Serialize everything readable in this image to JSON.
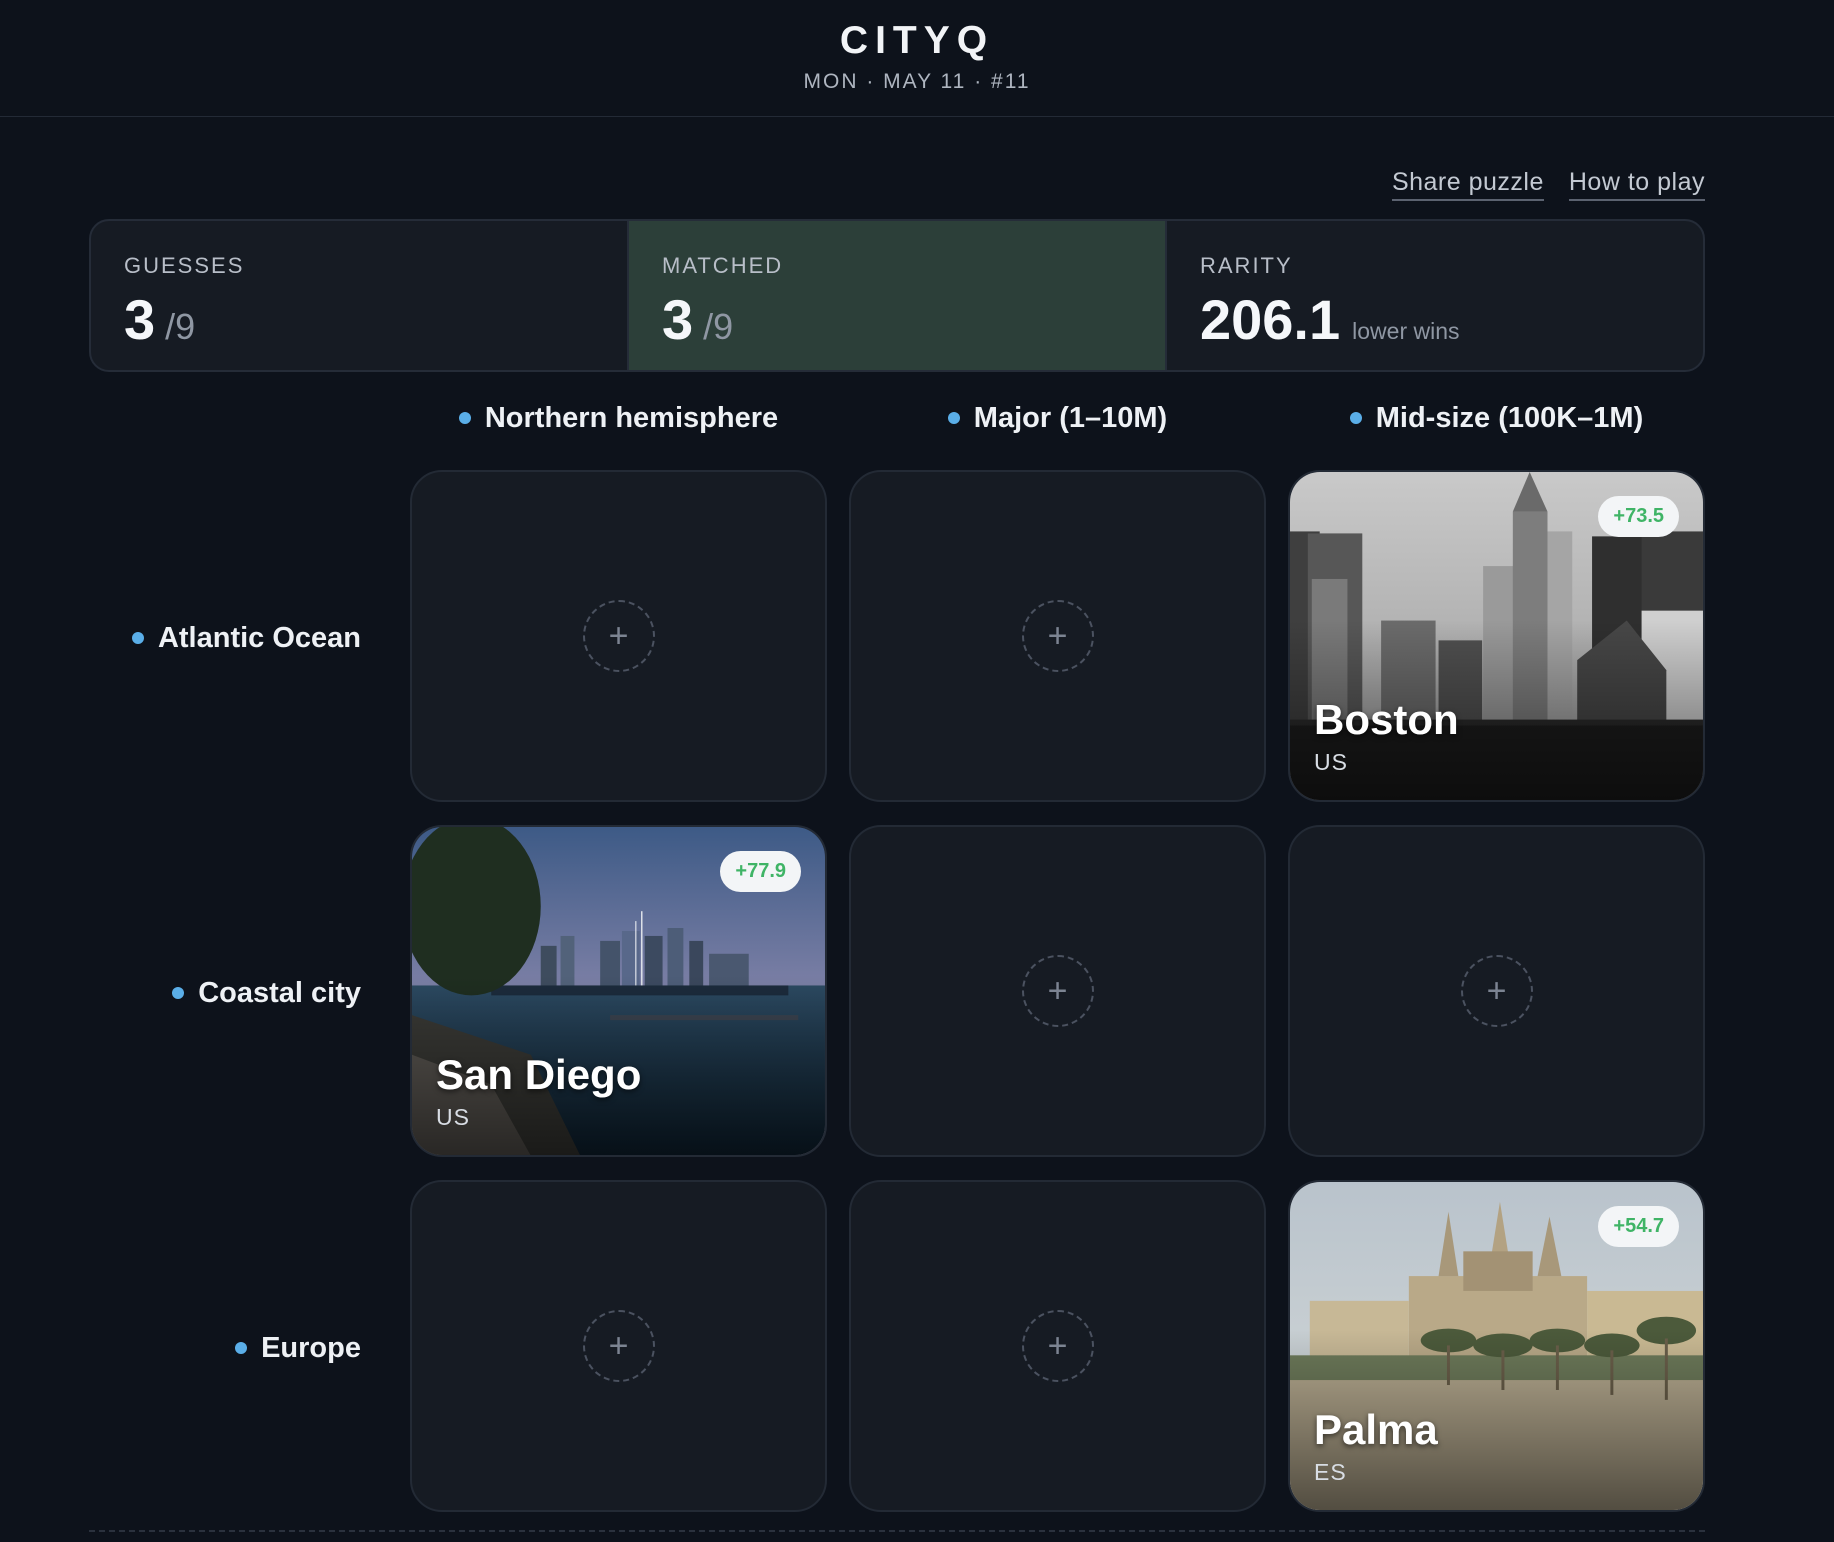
{
  "header": {
    "brand": "CITYQ",
    "date": "MON · MAY 11 · #11"
  },
  "links": {
    "share": "Share puzzle",
    "how_to_play": "How to play"
  },
  "stats": {
    "guesses": {
      "label": "GUESSES",
      "value": "3",
      "total": "/9"
    },
    "matched": {
      "label": "MATCHED",
      "value": "3",
      "total": "/9"
    },
    "rarity": {
      "label": "RARITY",
      "value": "206.1",
      "note": "lower wins"
    }
  },
  "columns": [
    "Northern hemisphere",
    "Major (1–10M)",
    "Mid-size (100K–1M)"
  ],
  "rows": [
    "Atlantic Ocean",
    "Coastal city",
    "Europe"
  ],
  "grid": {
    "add_symbol": "+",
    "answers": {
      "boston": {
        "name": "Boston",
        "country": "US",
        "score": "+73.5"
      },
      "san_diego": {
        "name": "San Diego",
        "country": "US",
        "score": "+77.9"
      },
      "palma": {
        "name": "Palma",
        "country": "ES",
        "score": "+54.7"
      }
    }
  },
  "colors": {
    "accent_dot": "#5aaee8",
    "matched_bg": "#2c3f39",
    "score_green": "#3fb466"
  }
}
